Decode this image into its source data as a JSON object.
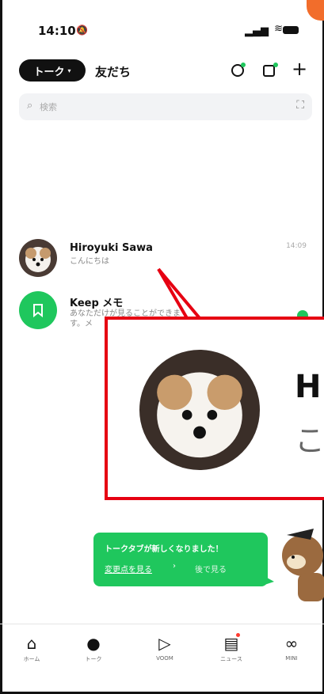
{
  "status_bar": {
    "time": "14:10",
    "mute_icon": "bell-slash-icon"
  },
  "header": {
    "active_tab": "トーク",
    "friends_tab": "友だち",
    "icons": [
      "chat-add-icon",
      "new-square-icon",
      "plus-icon"
    ]
  },
  "search": {
    "placeholder": "検索"
  },
  "chats": [
    {
      "name": "Hiroyuki Sawa",
      "message": "こんにちは",
      "time": "14:09"
    },
    {
      "name": "Keep メモ",
      "message": "あなただけが見ることができま\nす。メ",
      "time": ""
    }
  ],
  "zoom": {
    "name_partial": "H",
    "message_partial": "こ",
    "highlight_color": "#e60012"
  },
  "banner": {
    "title": "トークタブが新しくなりました！",
    "link": "変更点を見る",
    "later": "後で見る"
  },
  "nav": [
    {
      "label": "ホーム",
      "icon": "home-icon"
    },
    {
      "label": "トーク",
      "icon": "chat-bubble-icon"
    },
    {
      "label": "VOOM",
      "icon": "voom-play-icon"
    },
    {
      "label": "ニュース",
      "icon": "news-icon"
    },
    {
      "label": "MINI",
      "icon": "mini-icon"
    }
  ],
  "colors": {
    "line_green": "#1fc75d",
    "accent_orange": "#f26d2b"
  }
}
